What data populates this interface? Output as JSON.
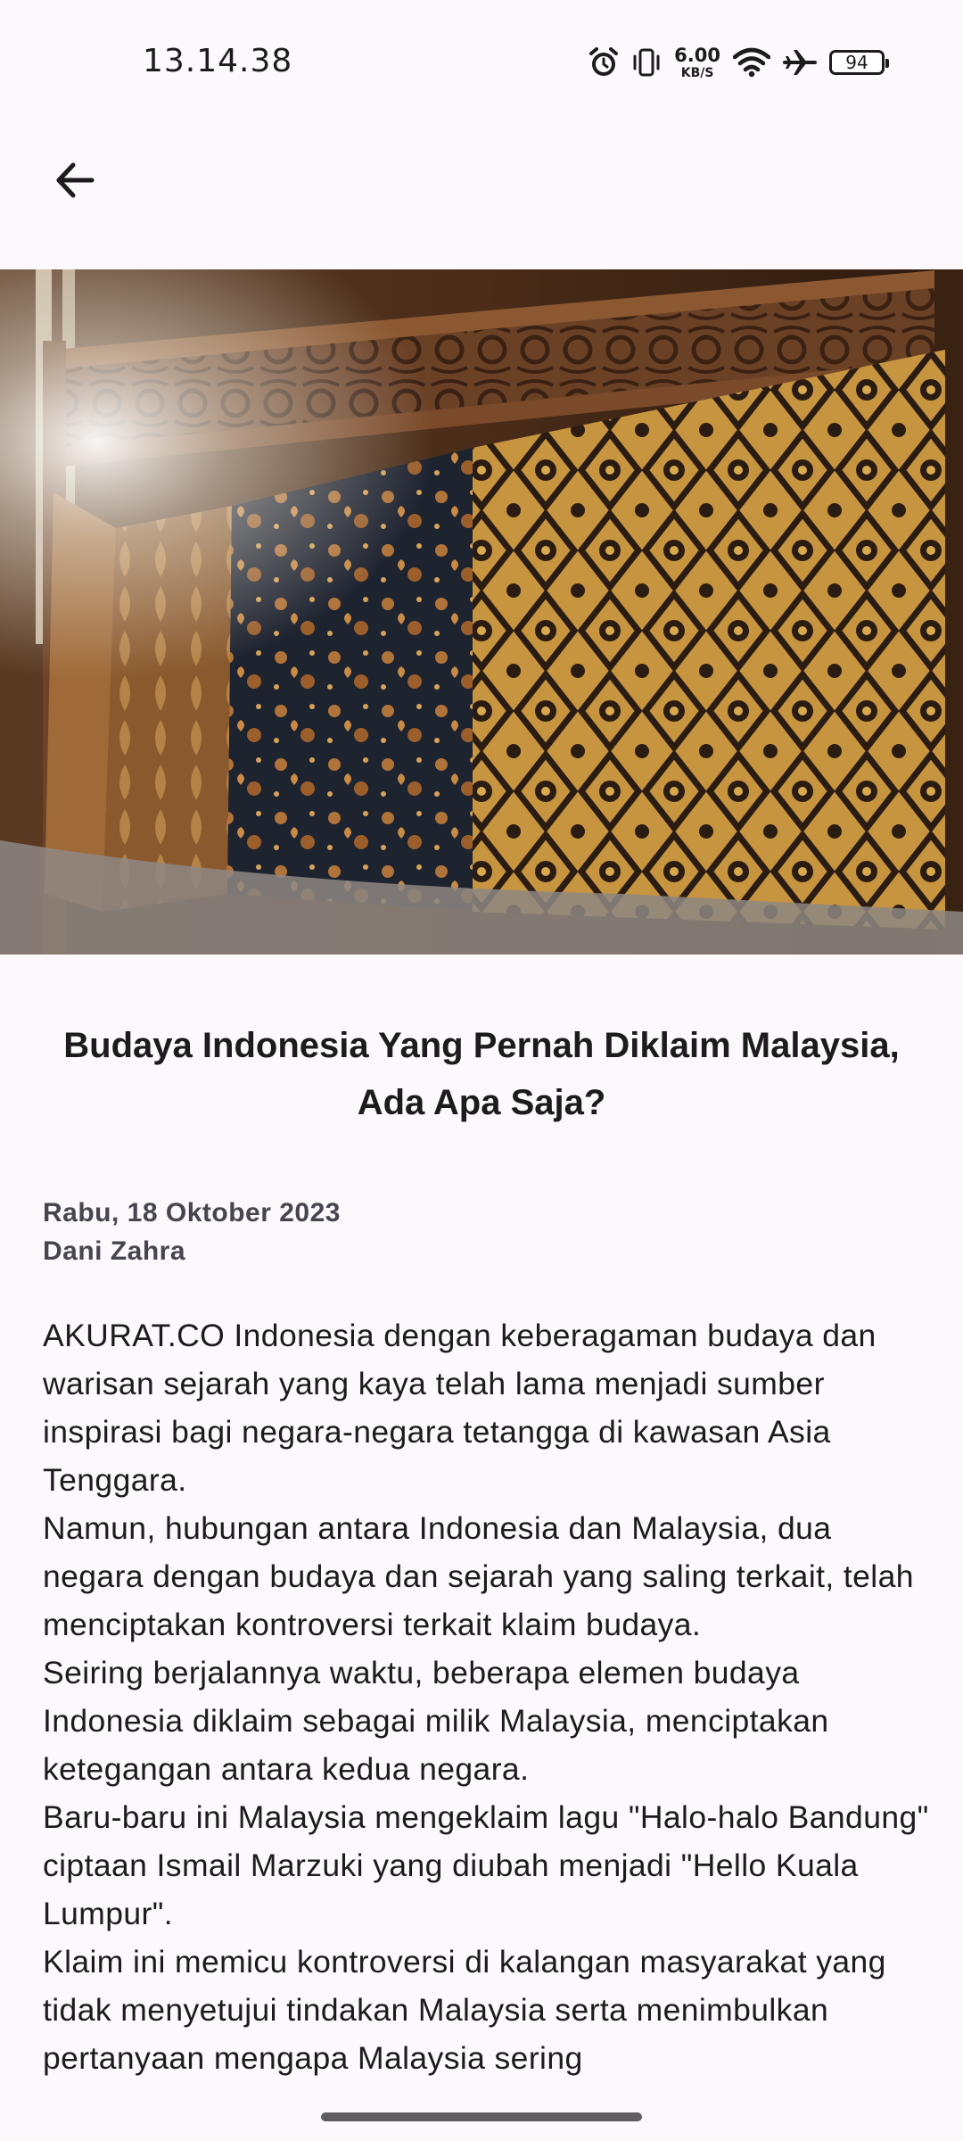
{
  "status_bar": {
    "time": "13.14.38",
    "net_speed_value": "6.00",
    "net_speed_unit": "KB/S",
    "battery_level": "94",
    "icons": [
      "alarm-icon",
      "vibrate-icon",
      "wifi-icon",
      "airplane-icon",
      "battery-icon"
    ]
  },
  "app_bar": {
    "back_icon": "arrow-left-icon"
  },
  "article": {
    "image_subject": "batik cloth hanging on carved wooden bed frame",
    "title": "Budaya Indonesia Yang Pernah Diklaim Malaysia, Ada Apa Saja?",
    "date": "Rabu, 18 Oktober 2023",
    "author": "Dani Zahra",
    "paragraphs": [
      "AKURAT.CO Indonesia dengan keberagaman budaya dan warisan sejarah yang kaya telah lama menjadi sumber inspirasi bagi negara-negara tetangga di kawasan Asia Tenggara.",
      "Namun, hubungan antara Indonesia dan Malaysia, dua negara dengan budaya dan sejarah yang saling terkait, telah menciptakan kontroversi terkait klaim budaya.",
      "Seiring berjalannya waktu, beberapa elemen budaya Indonesia diklaim sebagai milik Malaysia, menciptakan ketegangan antara kedua negara.",
      "Baru-baru ini Malaysia mengeklaim lagu \"Halo-halo Bandung\" ciptaan Ismail Marzuki yang diubah menjadi \"Hello Kuala Lumpur\".",
      "Klaim ini memicu kontroversi di kalangan masyarakat yang tidak menyetujui tindakan Malaysia serta menimbulkan pertanyaan mengapa Malaysia sering"
    ]
  },
  "colors": {
    "background": "#fcf8fc",
    "text": "#1d1b1f",
    "meta_text": "#49454e"
  }
}
